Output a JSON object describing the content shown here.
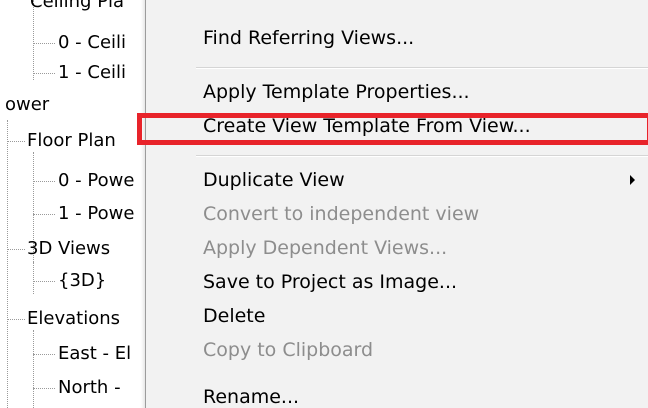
{
  "tree": {
    "items": [
      {
        "label": "Ceiling Pla"
      },
      {
        "label": "0 - Ceili"
      },
      {
        "label": "1 - Ceili"
      },
      {
        "label": "ower"
      },
      {
        "label": "Floor Plan"
      },
      {
        "label": "0 - Powe"
      },
      {
        "label": "1 - Powe"
      },
      {
        "label": "3D Views"
      },
      {
        "label": "{3D}"
      },
      {
        "label": "Elevations"
      },
      {
        "label": "East - El"
      },
      {
        "label": "North -"
      }
    ]
  },
  "context_menu": {
    "items": [
      {
        "label": "Find Referring Views...",
        "enabled": true
      },
      {
        "label": "Apply Template Properties...",
        "enabled": true
      },
      {
        "label": "Create View Template From View...",
        "enabled": true,
        "highlighted": true
      },
      {
        "label": "Duplicate View",
        "enabled": true,
        "has_submenu": true
      },
      {
        "label": "Convert to independent view",
        "enabled": false
      },
      {
        "label": "Apply Dependent Views...",
        "enabled": false
      },
      {
        "label": "Save to Project as Image...",
        "enabled": true
      },
      {
        "label": "Delete",
        "enabled": true
      },
      {
        "label": "Copy to Clipboard",
        "enabled": false
      },
      {
        "label": "Rename...",
        "enabled": true
      }
    ]
  },
  "colors": {
    "highlight_border": "#e8232a",
    "menu_background": "#f2f2f2",
    "disabled_text": "#8d8d8d"
  }
}
